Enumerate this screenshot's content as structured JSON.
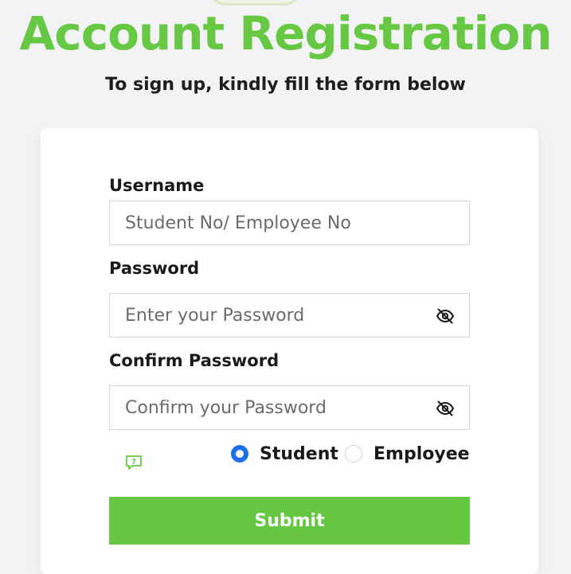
{
  "header": {
    "title": "Account Registration",
    "subtitle": "To sign up, kindly fill the form below"
  },
  "form": {
    "username": {
      "label": "Username",
      "placeholder": "Student No/ Employee No",
      "value": ""
    },
    "password": {
      "label": "Password",
      "placeholder": "Enter your Password",
      "value": "",
      "toggle_icon": "eye-off-icon"
    },
    "confirm_password": {
      "label": "Confirm Password",
      "placeholder": "Confirm your Password",
      "value": "",
      "toggle_icon": "eye-off-icon"
    },
    "help_icon": "help-bubble-icon",
    "role": {
      "options": [
        "Student",
        "Employee"
      ],
      "selected": "Student"
    },
    "submit_label": "Submit"
  },
  "colors": {
    "brand_green": "#67c843",
    "radio_selected": "#1f6feb",
    "background": "#f3f3f6"
  }
}
